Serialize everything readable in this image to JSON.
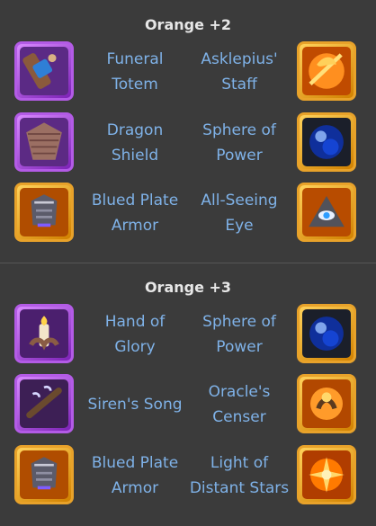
{
  "sections": [
    {
      "title": "Orange +2",
      "rows": [
        {
          "left": {
            "name_line1": "Funeral",
            "name_line2": "Totem",
            "icon": "funeral-totem-icon"
          },
          "right": {
            "name_line1": "Asklepius'",
            "name_line2": "Staff",
            "icon": "asklepius-staff-icon"
          }
        },
        {
          "left": {
            "name_line1": "Dragon",
            "name_line2": "Shield",
            "icon": "dragon-shield-icon"
          },
          "right": {
            "name_line1": "Sphere of",
            "name_line2": "Power",
            "icon": "sphere-of-power-icon"
          }
        },
        {
          "left": {
            "name_line1": "Blued Plate",
            "name_line2": "Armor",
            "icon": "blued-plate-armor-icon"
          },
          "right": {
            "name_line1": "All-Seeing",
            "name_line2": "Eye",
            "icon": "all-seeing-eye-icon"
          }
        }
      ]
    },
    {
      "title": "Orange +3",
      "rows": [
        {
          "left": {
            "name_line1": "Hand of",
            "name_line2": "Glory",
            "icon": "hand-of-glory-icon"
          },
          "right": {
            "name_line1": "Sphere of",
            "name_line2": "Power",
            "icon": "sphere-of-power-icon"
          }
        },
        {
          "left": {
            "name_line1": "Siren's Song",
            "name_line2": "",
            "icon": "sirens-song-icon"
          },
          "right": {
            "name_line1": "Oracle's",
            "name_line2": "Censer",
            "icon": "oracles-censer-icon"
          }
        },
        {
          "left": {
            "name_line1": "Blued Plate",
            "name_line2": "Armor",
            "icon": "blued-plate-armor-icon"
          },
          "right": {
            "name_line1": "Light of",
            "name_line2": "Distant Stars",
            "icon": "light-of-distant-stars-icon"
          }
        }
      ]
    }
  ],
  "colors": {
    "background": "#3b3b3b",
    "title": "#e7e7e7",
    "item_text": "#7fb2e8",
    "frame_purple": "#b35be6",
    "frame_orange": "#e8a22a"
  }
}
